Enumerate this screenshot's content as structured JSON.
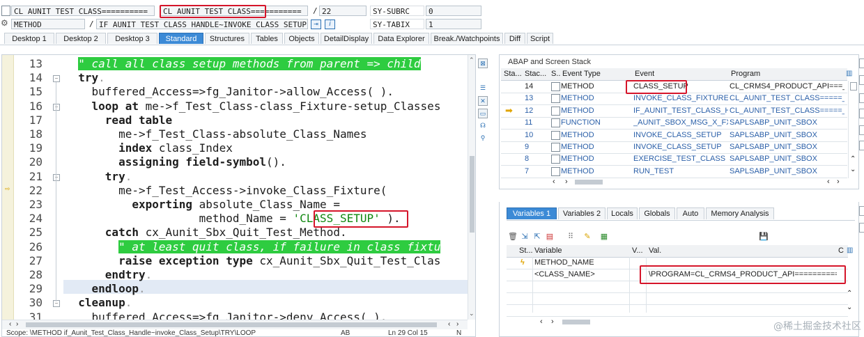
{
  "header": {
    "row1": {
      "class_field": "CL_AUNIT_TEST_CLASS==========",
      "class_field2": "CL_AUNIT_TEST_CLASS===========",
      "slash": "/",
      "line_no": "22",
      "var1_name": "SY-SUBRC",
      "var1_val": "0"
    },
    "row2": {
      "type": "METHOD",
      "slash": "/",
      "method": "IF_AUNIT_TEST_CLASS_HANDLE~INVOKE_CLASS_SETUP (_",
      "var2_name": "SY-TABIX",
      "var2_val": "1"
    }
  },
  "tabs": [
    "Desktop 1",
    "Desktop 2",
    "Desktop 3",
    "Standard",
    "Structures",
    "Tables",
    "Objects",
    "DetailDisplay",
    "Data Explorer",
    "Break./Watchpoints",
    "Diff",
    "Script"
  ],
  "active_tab": "Standard",
  "editor": {
    "lines": [
      {
        "n": "13",
        "html": "  <span class=\"cm\">\" call all class setup methods from parent => child</span>"
      },
      {
        "n": "14",
        "html": "  <span class=\"kw\">try</span><span class=\"dot\">.</span>"
      },
      {
        "n": "15",
        "html": "    buffered_Access=>fg_Janitor->allow_Access( )."
      },
      {
        "n": "16",
        "html": "    <span class=\"kw\">loop at</span> me->f_Test_Class-class_Fixture-setup_Classes"
      },
      {
        "n": "17",
        "html": "      <span class=\"kw\">read table</span>"
      },
      {
        "n": "18",
        "html": "        me->f_Test_Class-absolute_Class_Names"
      },
      {
        "n": "19",
        "html": "        <span class=\"kw\">index</span> class_Index"
      },
      {
        "n": "20",
        "html": "        <span class=\"kw\">assigning field-symbol</span>(<class_Name>)."
      },
      {
        "n": "21",
        "html": "      <span class=\"kw\">try</span><span class=\"dot\">.</span>"
      },
      {
        "n": "22",
        "html": "        me->f_Test_Access->invoke_Class_Fixture("
      },
      {
        "n": "23",
        "html": "          <span class=\"kw\">exporting</span> absolute_Class_Name = <class_Name>"
      },
      {
        "n": "24",
        "html": "                    method_Name = <span class=\"str\">'CLASS_SETUP'</span> )."
      },
      {
        "n": "25",
        "html": "      <span class=\"kw\">catch</span> cx_Aunit_Sbx_Quit_Test_Method."
      },
      {
        "n": "26",
        "html": "        <span class=\"cm\">\" at least quit class, if failure in class fixtu</span>"
      },
      {
        "n": "27",
        "html": "        <span class=\"kw\">raise exception type</span> cx_Aunit_Sbx_Quit_Test_Clas"
      },
      {
        "n": "28",
        "html": "      <span class=\"kw\">endtry</span><span class=\"dot\">.</span>"
      },
      {
        "n": "29",
        "html": "    <span class=\"kw\">endloop</span><span class=\"dot\">.</span>"
      },
      {
        "n": "30",
        "html": "  <span class=\"kw\">cleanup</span><span class=\"dot\">.</span>"
      },
      {
        "n": "31",
        "html": "    buffered_Access=>fg_Janitor->deny_Access( )."
      }
    ],
    "status_scope": "Scope: \\METHOD if_Aunit_Test_Class_Handle~invoke_Class_Setup\\TRY\\LOOP",
    "status_ab": "AB",
    "status_pos": "Ln 29 Col 15",
    "status_n": "N"
  },
  "stack": {
    "title": "ABAP and Screen Stack",
    "columns": [
      "Sta...",
      "Stac...",
      "S..",
      "Event Type",
      "Event",
      "Program"
    ],
    "rows": [
      {
        "level": "14",
        "type": "METHOD",
        "event": "CLASS_SETUP",
        "program": "CL_CRMS4_PRODUCT_API===_"
      },
      {
        "level": "13",
        "type": "METHOD",
        "event": "INVOKE_CLASS_FIXTURE",
        "program": "CL_AUNIT_TEST_CLASS=====_"
      },
      {
        "level": "12",
        "type": "METHOD",
        "event": "IF_AUNIT_TEST_CLASS_H_",
        "program": "CL_AUNIT_TEST_CLASS=====_"
      },
      {
        "level": "11",
        "type": "FUNCTION",
        "event": "_AUNIT_SBOX_MSG_X_FX_",
        "program": "SAPLSABP_UNIT_SBOX"
      },
      {
        "level": "10",
        "type": "METHOD",
        "event": "INVOKE_CLASS_SETUP",
        "program": "SAPLSABP_UNIT_SBOX"
      },
      {
        "level": "9",
        "type": "METHOD",
        "event": "INVOKE_CLASS_SETUP",
        "program": "SAPLSABP_UNIT_SBOX"
      },
      {
        "level": "8",
        "type": "METHOD",
        "event": "EXERCISE_TEST_CLASS",
        "program": "SAPLSABP_UNIT_SBOX"
      },
      {
        "level": "7",
        "type": "METHOD",
        "event": "RUN_TEST",
        "program": "SAPLSABP_UNIT_SBOX"
      }
    ]
  },
  "vars": {
    "tabs": [
      "Variables 1",
      "Variables 2",
      "Locals",
      "Globals",
      "Auto",
      "Memory Analysis"
    ],
    "columns": [
      "St...",
      "Variable",
      "V...",
      "Val."
    ],
    "rows": [
      {
        "name": "METHOD_NAME",
        "val": ""
      },
      {
        "name": "<CLASS_NAME>",
        "val": "\\PROGRAM=CL_CRMS4_PRODUCT_API==========_"
      }
    ]
  },
  "watermark": "@稀土掘金技术社区"
}
